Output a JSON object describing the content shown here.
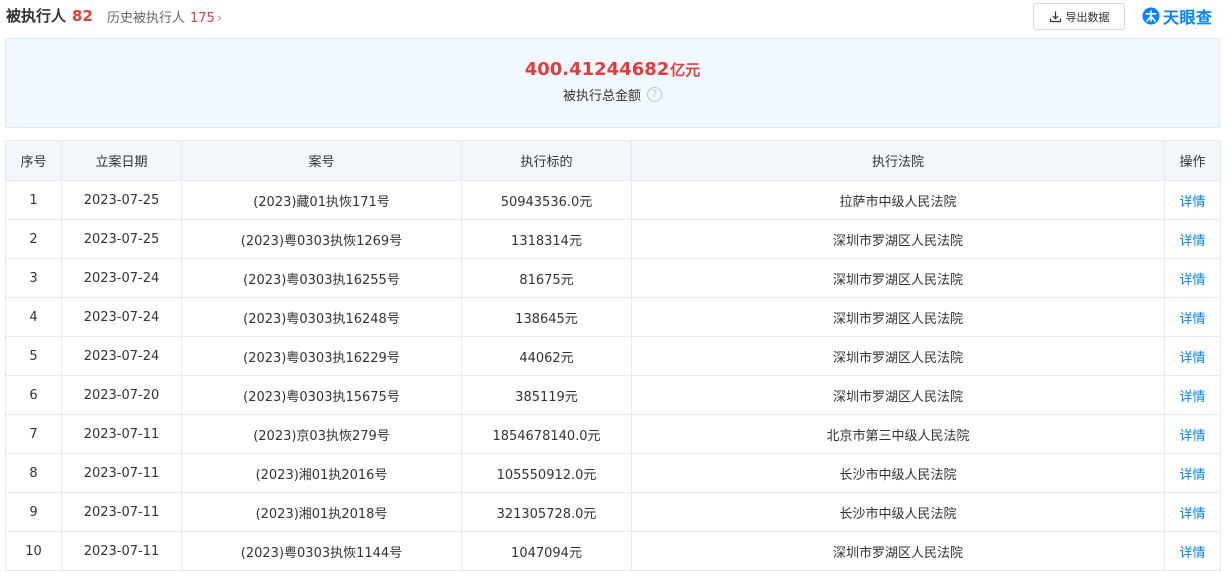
{
  "header": {
    "title": "被执行人",
    "title_count": "82",
    "history_label": "历史被执行人",
    "history_count": "175",
    "history_chevron": "›",
    "export_label": "导出数据",
    "export_icon": "download-icon",
    "brand_name": "天眼查",
    "brand_icon": "tianyancha-logo-icon"
  },
  "summary": {
    "amount": "400.41244682",
    "unit": "亿元",
    "label": "被执行总金额",
    "help_glyph": "?"
  },
  "table": {
    "columns": [
      "序号",
      "立案日期",
      "案号",
      "执行标的",
      "执行法院",
      "操作"
    ],
    "rows": [
      {
        "index": "1",
        "date": "2023-07-25",
        "case_no": "(2023)藏01执恢171号",
        "amount": "50943536.0元",
        "court": "拉萨市中级人民法院",
        "action": "详情"
      },
      {
        "index": "2",
        "date": "2023-07-25",
        "case_no": "(2023)粤0303执恢1269号",
        "amount": "1318314元",
        "court": "深圳市罗湖区人民法院",
        "action": "详情"
      },
      {
        "index": "3",
        "date": "2023-07-24",
        "case_no": "(2023)粤0303执16255号",
        "amount": "81675元",
        "court": "深圳市罗湖区人民法院",
        "action": "详情"
      },
      {
        "index": "4",
        "date": "2023-07-24",
        "case_no": "(2023)粤0303执16248号",
        "amount": "138645元",
        "court": "深圳市罗湖区人民法院",
        "action": "详情"
      },
      {
        "index": "5",
        "date": "2023-07-24",
        "case_no": "(2023)粤0303执16229号",
        "amount": "44062元",
        "court": "深圳市罗湖区人民法院",
        "action": "详情"
      },
      {
        "index": "6",
        "date": "2023-07-20",
        "case_no": "(2023)粤0303执15675号",
        "amount": "385119元",
        "court": "深圳市罗湖区人民法院",
        "action": "详情"
      },
      {
        "index": "7",
        "date": "2023-07-11",
        "case_no": "(2023)京03执恢279号",
        "amount": "1854678140.0元",
        "court": "北京市第三中级人民法院",
        "action": "详情"
      },
      {
        "index": "8",
        "date": "2023-07-11",
        "case_no": "(2023)湘01执2016号",
        "amount": "105550912.0元",
        "court": "长沙市中级人民法院",
        "action": "详情"
      },
      {
        "index": "9",
        "date": "2023-07-11",
        "case_no": "(2023)湘01执2018号",
        "amount": "321305728.0元",
        "court": "长沙市中级人民法院",
        "action": "详情"
      },
      {
        "index": "10",
        "date": "2023-07-11",
        "case_no": "(2023)粤0303执恢1144号",
        "amount": "1047094元",
        "court": "深圳市罗湖区人民法院",
        "action": "详情"
      }
    ]
  },
  "colors": {
    "accent_red": "#e43b3b",
    "link_blue": "#0084ff",
    "summary_bg": "#f2f8ff",
    "header_bg": "#f3f6fb"
  }
}
